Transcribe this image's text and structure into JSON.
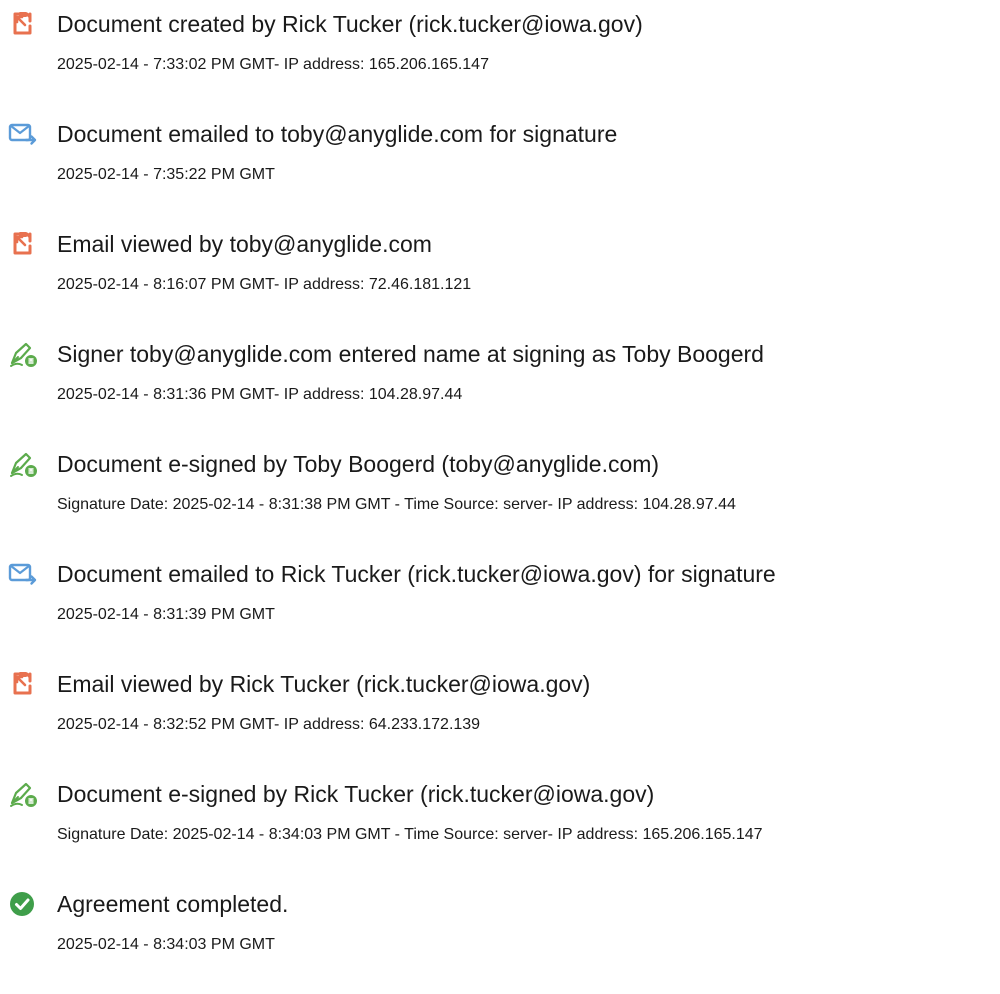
{
  "events": [
    {
      "icon": "document-created-icon",
      "title": "Document created by Rick Tucker (rick.tucker@iowa.gov)",
      "detail": "2025-02-14 - 7:33:02 PM GMT- IP address: 165.206.165.147"
    },
    {
      "icon": "email-sent-icon",
      "title": "Document emailed to toby@anyglide.com for signature",
      "detail": "2025-02-14 - 7:35:22 PM GMT"
    },
    {
      "icon": "document-viewed-icon",
      "title": "Email viewed by toby@anyglide.com",
      "detail": "2025-02-14 - 8:16:07 PM GMT- IP address: 72.46.181.121"
    },
    {
      "icon": "esign-pen-icon",
      "title": "Signer toby@anyglide.com entered name at signing as Toby Boogerd",
      "detail": "2025-02-14 - 8:31:36 PM GMT- IP address: 104.28.97.44"
    },
    {
      "icon": "esign-pen-icon",
      "title": "Document e-signed by Toby Boogerd (toby@anyglide.com)",
      "detail": "Signature Date: 2025-02-14 - 8:31:38 PM GMT - Time Source: server- IP address: 104.28.97.44"
    },
    {
      "icon": "email-sent-icon",
      "title": "Document emailed to Rick Tucker (rick.tucker@iowa.gov) for signature",
      "detail": "2025-02-14 - 8:31:39 PM GMT"
    },
    {
      "icon": "document-viewed-icon",
      "title": "Email viewed by Rick Tucker (rick.tucker@iowa.gov)",
      "detail": "2025-02-14 - 8:32:52 PM GMT- IP address: 64.233.172.139"
    },
    {
      "icon": "esign-pen-icon",
      "title": "Document e-signed by Rick Tucker (rick.tucker@iowa.gov)",
      "detail": "Signature Date: 2025-02-14 - 8:34:03 PM GMT - Time Source: server- IP address: 165.206.165.147"
    },
    {
      "icon": "check-circle-icon",
      "title": "Agreement completed.",
      "detail": "2025-02-14 - 8:34:03 PM GMT"
    }
  ],
  "colors": {
    "document_icon": "#e8714f",
    "email_icon": "#5b9bd8",
    "pen_icon": "#5cab4c",
    "check_icon": "#3f9e4a",
    "text": "#1a1a1a"
  }
}
